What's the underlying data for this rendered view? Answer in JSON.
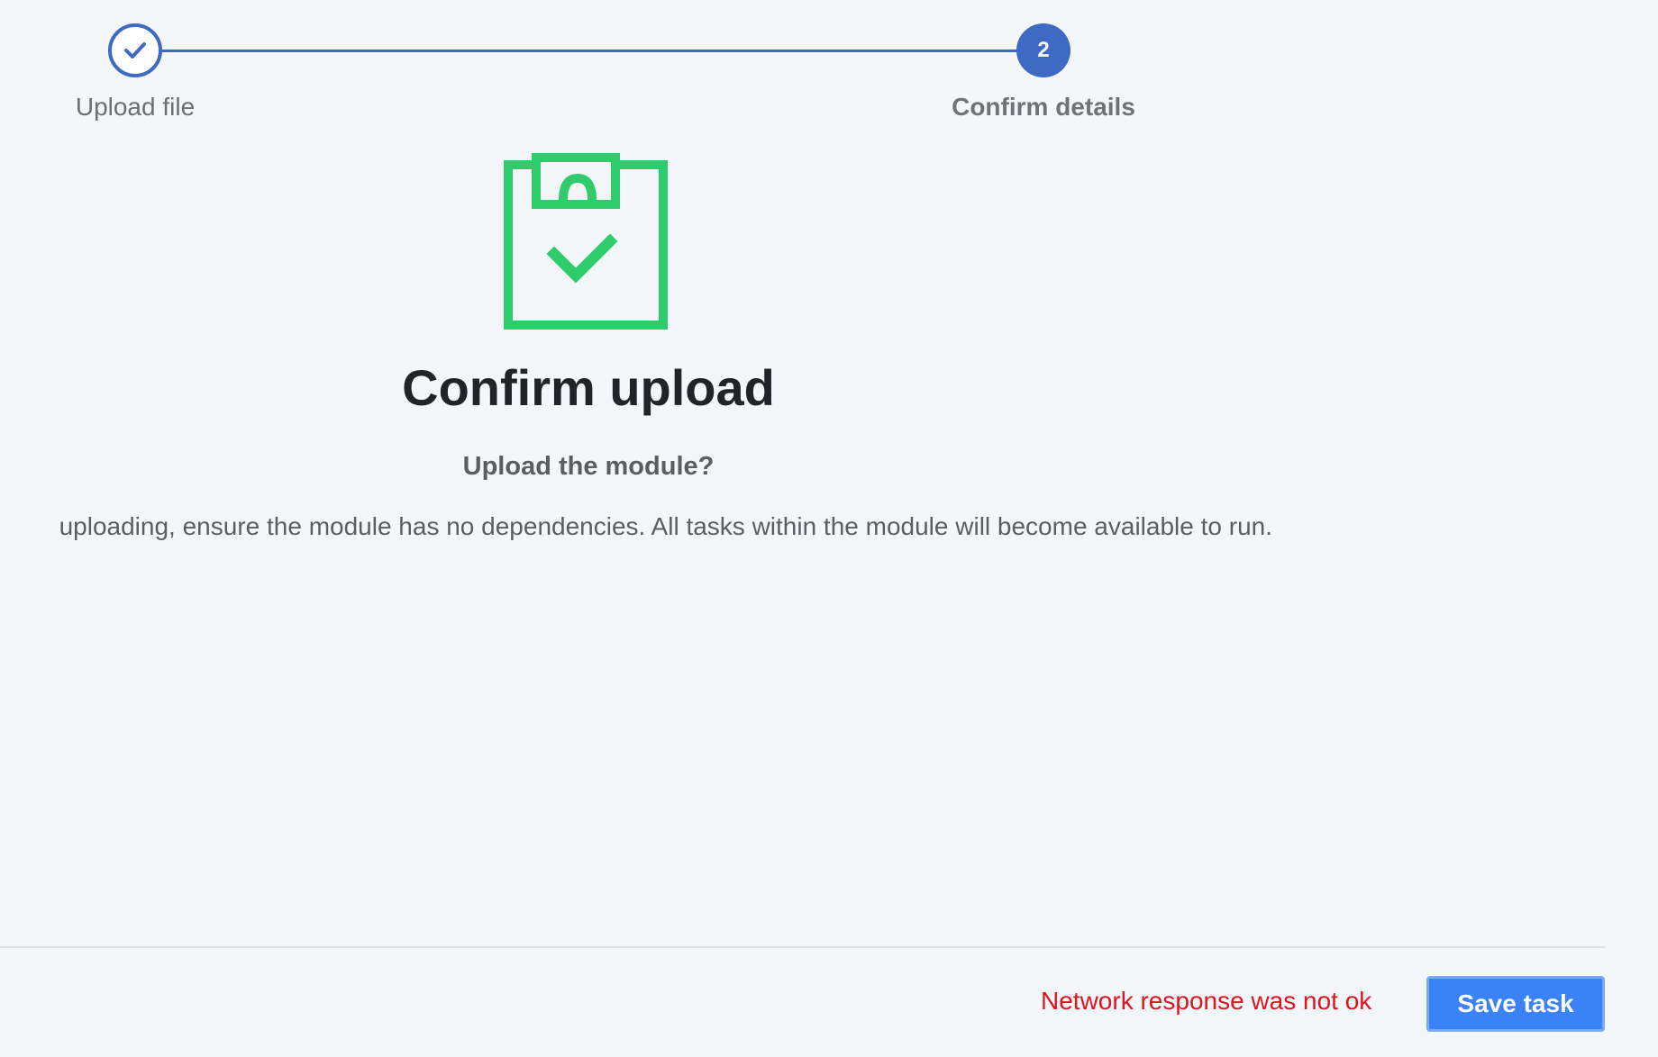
{
  "stepper": {
    "steps": [
      {
        "label": "Upload file",
        "status": "completed",
        "icon": "check-icon"
      },
      {
        "label": "Confirm details",
        "status": "active",
        "number": "2"
      }
    ],
    "accent_color": "#3f6ac4"
  },
  "main": {
    "illustration_icon": "clipboard-check-icon",
    "illustration_color": "#2ecc6a",
    "title": "Confirm upload",
    "subtitle": "Upload the module?",
    "description": "uploading, ensure the module has no dependencies. All tasks within the module will become available to run."
  },
  "footer": {
    "error_message": "Network response was not ok",
    "error_color": "#e0141e",
    "save_label": "Save task",
    "save_color": "#3b82f6"
  }
}
